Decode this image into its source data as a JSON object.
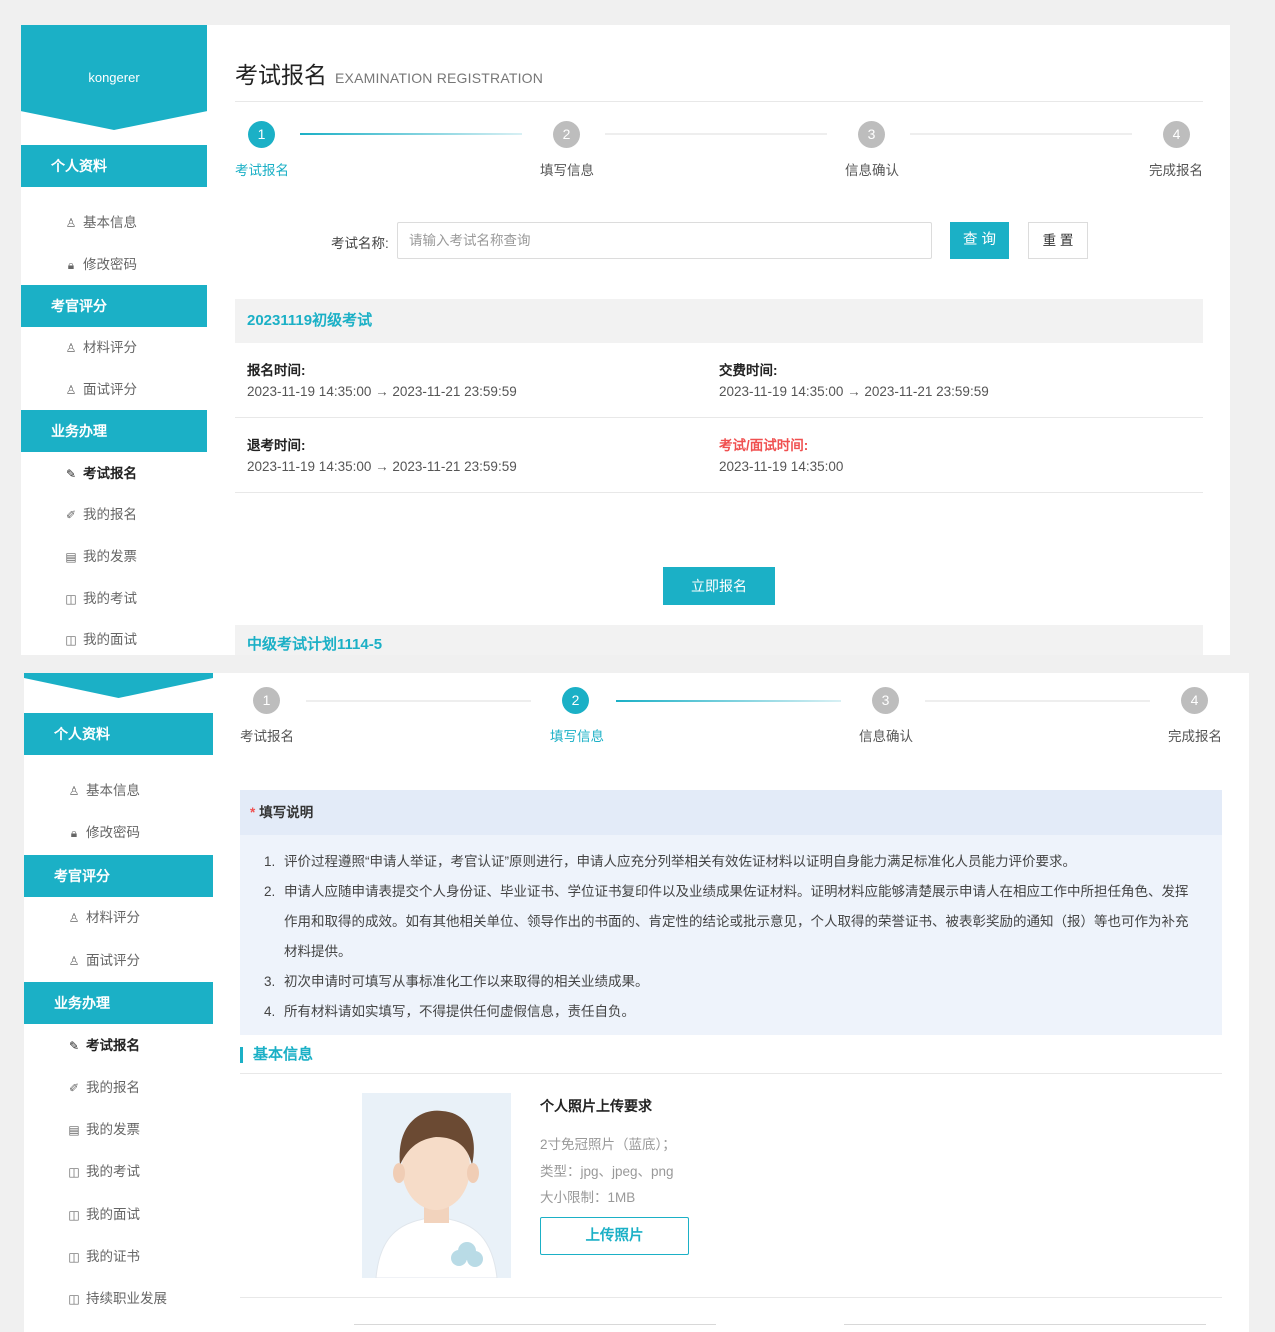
{
  "user": {
    "name": "kongerer"
  },
  "sidebar": {
    "sections": [
      {
        "title": "个人资料",
        "items": [
          {
            "label": "基本信息",
            "icon": "user-icon"
          },
          {
            "label": "修改密码",
            "icon": "lock-icon"
          }
        ]
      },
      {
        "title": "考官评分",
        "items": [
          {
            "label": "材料评分",
            "icon": "user-icon"
          },
          {
            "label": "面试评分",
            "icon": "user-icon"
          }
        ]
      },
      {
        "title": "业务办理",
        "items": [
          {
            "label": "考试报名",
            "icon": "pencil-icon",
            "active": true
          },
          {
            "label": "我的报名",
            "icon": "edit-square-icon"
          },
          {
            "label": "我的发票",
            "icon": "invoice-icon"
          },
          {
            "label": "我的考试",
            "icon": "book-icon"
          },
          {
            "label": "我的面试",
            "icon": "book-icon"
          },
          {
            "label": "我的证书",
            "icon": "book-icon"
          },
          {
            "label": "持续职业发展",
            "icon": "book-icon"
          }
        ]
      }
    ]
  },
  "page": {
    "title": "考试报名",
    "subtitle": "EXAMINATION REGISTRATION"
  },
  "steps": [
    {
      "num": "1",
      "label": "考试报名"
    },
    {
      "num": "2",
      "label": "填写信息"
    },
    {
      "num": "3",
      "label": "信息确认"
    },
    {
      "num": "4",
      "label": "完成报名"
    }
  ],
  "search": {
    "label": "考试名称:",
    "placeholder": "请输入考试名称查询",
    "query_label": "查 询",
    "reset_label": "重 置"
  },
  "exams": [
    {
      "name": "20231119初级考试",
      "reg_label": "报名时间:",
      "reg_time": "2023-11-19 14:35:00  →  2023-11-21 23:59:59",
      "fee_label": "交费时间:",
      "fee_time": "2023-11-19 14:35:00  →  2023-11-21 23:59:59",
      "withdraw_label": "退考时间:",
      "withdraw_time": "2023-11-19 14:35:00  →  2023-11-21 23:59:59",
      "exam_label": "考试/面试时间:",
      "exam_time": "2023-11-19 14:35:00",
      "apply_label": "立即报名"
    },
    {
      "name": "中级考试计划1114-5"
    }
  ],
  "instructions": {
    "title": "填写说明",
    "items": [
      {
        "num": "1.",
        "text": "评价过程遵照“申请人举证，考官认证”原则进行，申请人应充分列举相关有效佐证材料以证明自身能力满足标准化人员能力评价要求。"
      },
      {
        "num": "2.",
        "text": "申请人应随申请表提交个人身份证、毕业证书、学位证书复印件以及业绩成果佐证材料。证明材料应能够清楚展示申请人在相应工作中所担任角色、发挥作用和取得的成效。如有其他相关单位、领导作出的书面的、肯定性的结论或批示意见，个人取得的荣誉证书、被表彰奖励的通知（报）等也可作为补充材料提供。"
      },
      {
        "num": "3.",
        "text": "初次申请时可填写从事标准化工作以来取得的相关业绩成果。"
      },
      {
        "num": "4.",
        "text": "所有材料请如实填写，不得提供任何虚假信息，责任自负。"
      }
    ]
  },
  "basic_info": {
    "title": "基本信息",
    "photo_title": "个人照片上传要求",
    "photo_req1": "2寸免冠照片（蓝底）；",
    "photo_req2": "类型：jpg、jpeg、png",
    "photo_req3": "大小限制：1MB",
    "upload_label": "上传照片"
  }
}
